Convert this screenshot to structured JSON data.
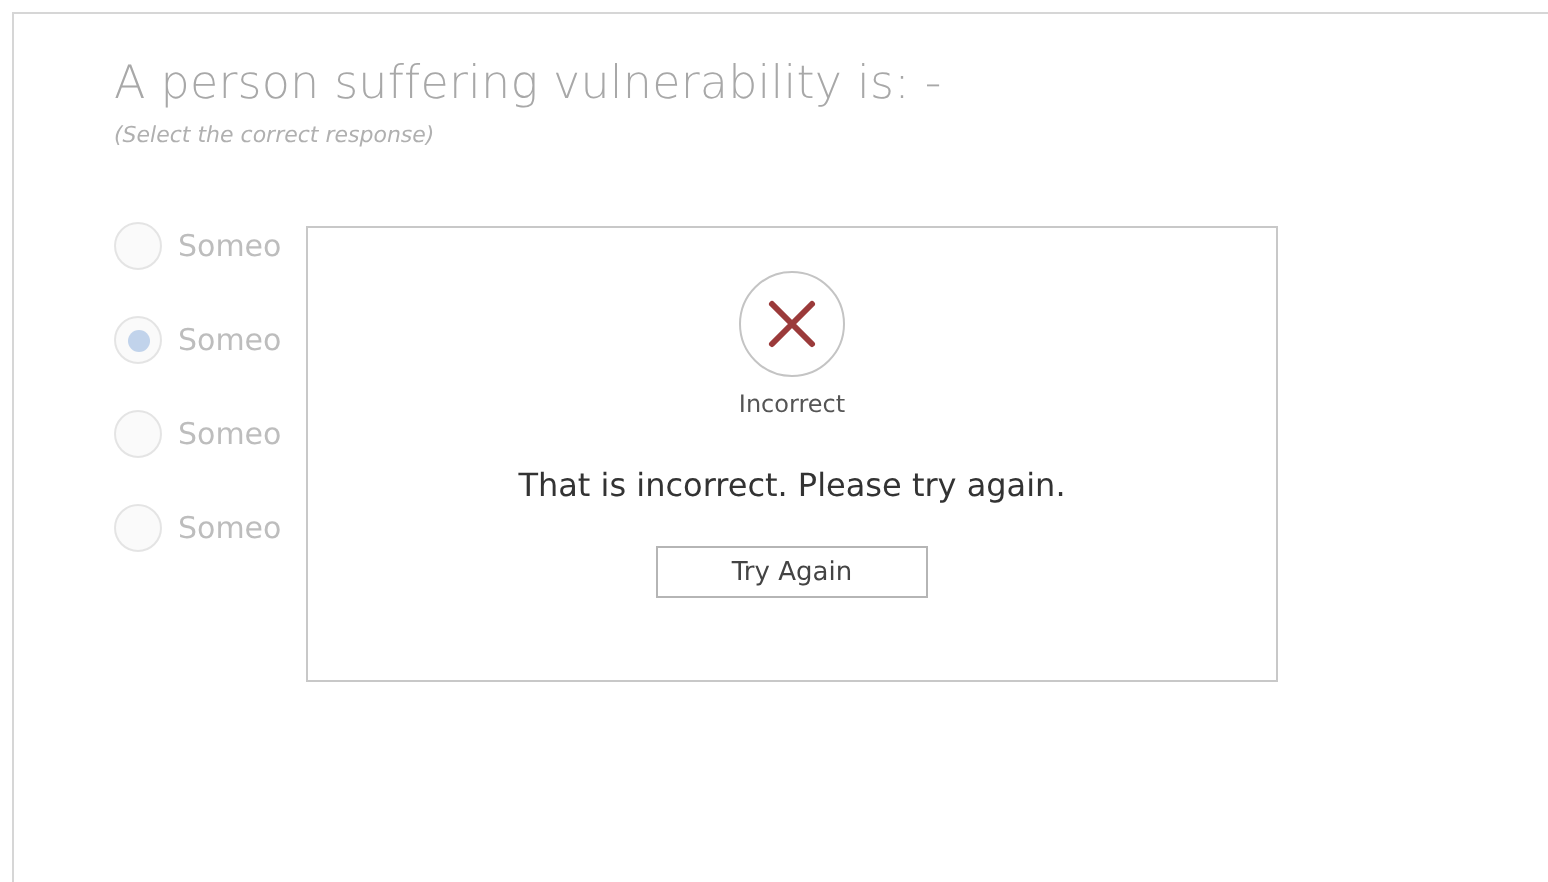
{
  "question": {
    "title": "A person suffering vulnerability is: -",
    "instruction": "(Select the correct response)"
  },
  "options": [
    {
      "label": "Someo",
      "selected": false
    },
    {
      "label": "Someo",
      "selected": true
    },
    {
      "label": "Someo",
      "selected": false
    },
    {
      "label": "Someo",
      "selected": false
    }
  ],
  "dialog": {
    "status": "Incorrect",
    "message": "That is incorrect. Please try again.",
    "button": "Try Again"
  }
}
